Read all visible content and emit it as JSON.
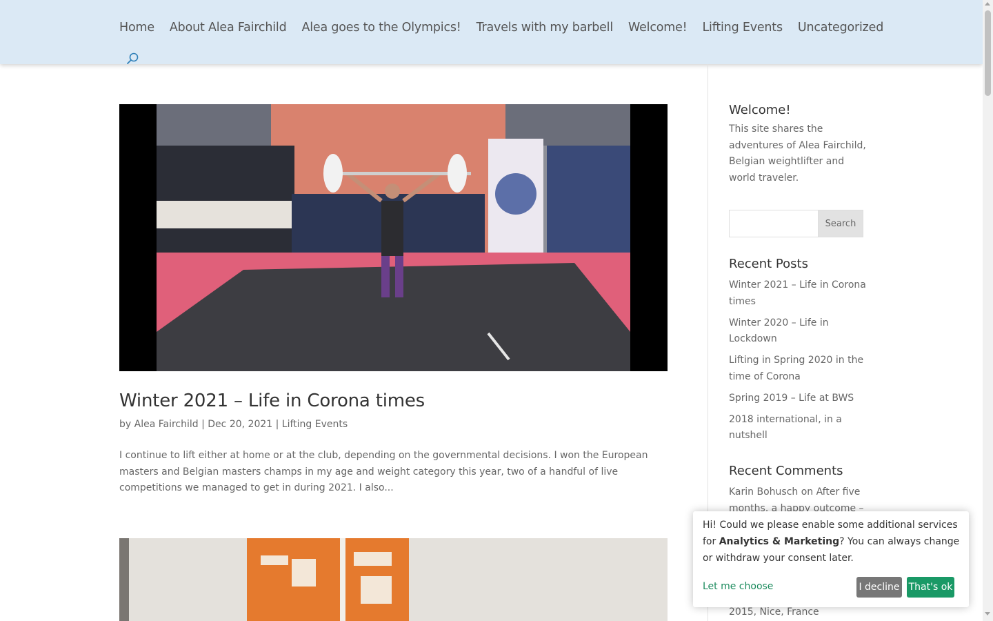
{
  "nav": {
    "items": [
      {
        "label": "Home"
      },
      {
        "label": "About Alea Fairchild"
      },
      {
        "label": "Alea goes to the Olympics!"
      },
      {
        "label": "Travels with my barbell"
      },
      {
        "label": "Welcome!"
      },
      {
        "label": "Lifting Events"
      },
      {
        "label": "Uncategorized"
      }
    ],
    "search_icon": "search-icon"
  },
  "post": {
    "title": "Winter 2021 – Life in Corona times",
    "meta_by": "by",
    "author": "Alea Fairchild",
    "sep": "|",
    "date": "Dec 20, 2021",
    "category": "Lifting Events",
    "excerpt": "I continue to lift either at home or at the club, depending on the governmental decisions. I won the European masters and Belgian masters champs in my age and weight category this year, two of a handful of live competitions we managed to get in during 2021. I also..."
  },
  "sidebar": {
    "welcome_title": "Welcome!",
    "welcome_text": "This site shares the adventures of Alea Fairchild, Belgian weightlifter and world traveler.",
    "search_button": "Search",
    "recent_posts_title": "Recent Posts",
    "recent_posts": [
      "Winter 2021 – Life in Corona times",
      "Winter 2020 – Life in Lockdown",
      "Lifting in Spring 2020 in the time of Corona",
      "Spring 2019 – Life at BWS",
      "2018 international, in a nutshell"
    ],
    "recent_comments_title": "Recent Comments",
    "recent_comment_text": "Karin Bohusch on After five months, a happy outcome –",
    "recent_comment_tail": "2015, Nice, France"
  },
  "consent": {
    "text_before": "Hi! Could we please enable some additional services for ",
    "text_bold": "Analytics & Marketing",
    "text_after": "? You can always change or withdraw your consent later.",
    "choose": "Let me choose",
    "decline": "I decline",
    "accept": "That's ok"
  },
  "colors": {
    "header_bg": "#dbe9f5",
    "accent_green": "#1a9966",
    "decline_gray": "#777777"
  }
}
